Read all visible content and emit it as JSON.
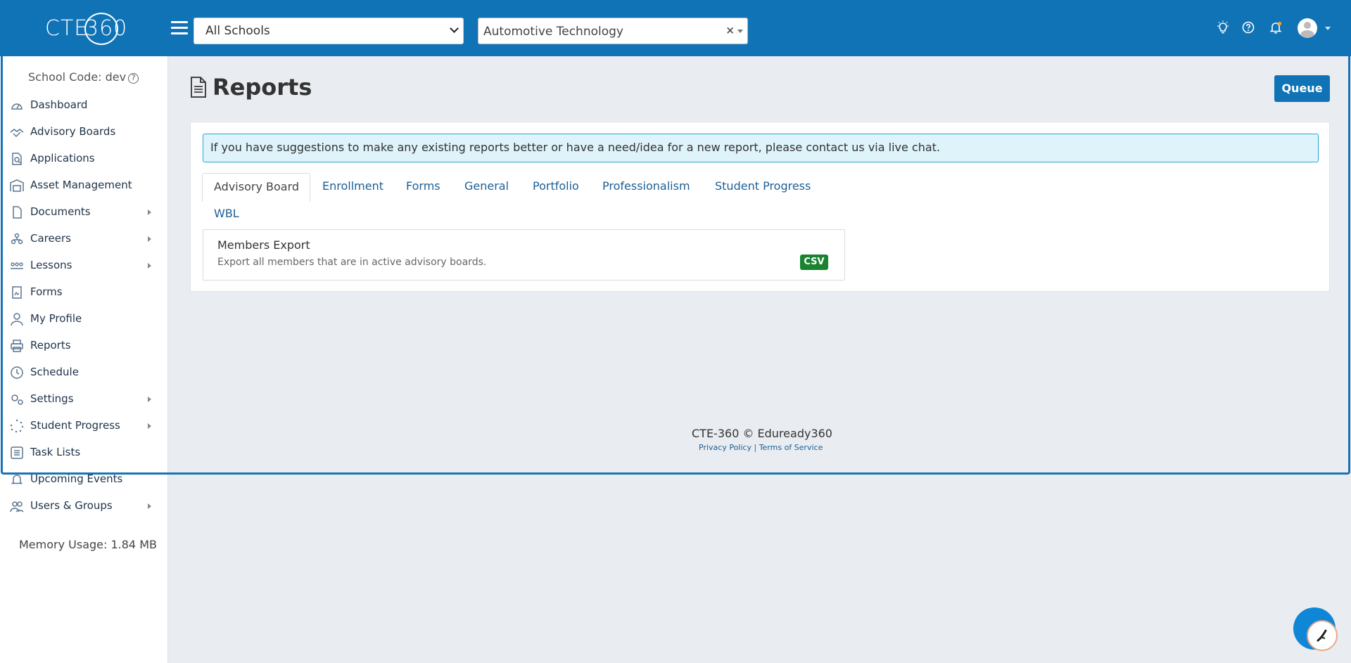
{
  "header": {
    "logo_text": "CTE",
    "logo_number": "360",
    "school_select": "All Schools",
    "program_select": "Automotive Technology",
    "program_clear": "×"
  },
  "sidebar": {
    "school_code": "School Code: dev",
    "help_glyph": "?",
    "items": [
      {
        "label": "Dashboard",
        "icon": "gauge-icon",
        "has_submenu": false
      },
      {
        "label": "Advisory Boards",
        "icon": "handshake-icon",
        "has_submenu": false
      },
      {
        "label": "Applications",
        "icon": "document-search-icon",
        "has_submenu": false
      },
      {
        "label": "Asset Management",
        "icon": "warehouse-icon",
        "has_submenu": false
      },
      {
        "label": "Documents",
        "icon": "file-icon",
        "has_submenu": true
      },
      {
        "label": "Careers",
        "icon": "people-tree-icon",
        "has_submenu": true
      },
      {
        "label": "Lessons",
        "icon": "classroom-icon",
        "has_submenu": true
      },
      {
        "label": "Forms",
        "icon": "form-icon",
        "has_submenu": false
      },
      {
        "label": "My Profile",
        "icon": "user-icon",
        "has_submenu": false
      },
      {
        "label": "Reports",
        "icon": "printer-icon",
        "has_submenu": false
      },
      {
        "label": "Schedule",
        "icon": "clock-icon",
        "has_submenu": false
      },
      {
        "label": "Settings",
        "icon": "gears-icon",
        "has_submenu": true
      },
      {
        "label": "Student Progress",
        "icon": "spinner-icon",
        "has_submenu": true
      },
      {
        "label": "Task Lists",
        "icon": "list-icon",
        "has_submenu": false
      },
      {
        "label": "Upcoming Events",
        "icon": "bell-icon",
        "has_submenu": false
      },
      {
        "label": "Users & Groups",
        "icon": "users-icon",
        "has_submenu": true
      }
    ],
    "memory": "Memory Usage: 1.84 MB"
  },
  "page": {
    "title": "Reports",
    "queue_label": "Queue",
    "alert": "If you have suggestions to make any existing reports better or have a need/idea for a new report, please contact us via live chat.",
    "tabs": [
      "Advisory Board",
      "Enrollment",
      "Forms",
      "General",
      "Portfolio",
      "Professionalism",
      "Student Progress",
      "WBL"
    ],
    "active_tab": "Advisory Board",
    "report": {
      "title": "Members Export",
      "description": "Export all members that are in active advisory boards.",
      "format": "CSV"
    }
  },
  "footer": {
    "copyright": "CTE-360 © Eduready360",
    "privacy": "Privacy Policy",
    "separator": "|",
    "terms": "Terms of Service"
  },
  "colors": {
    "brand": "#1073b6",
    "csv_badge": "#198332",
    "alert_bg": "#dff3fb",
    "alert_border": "#22a6d6"
  }
}
